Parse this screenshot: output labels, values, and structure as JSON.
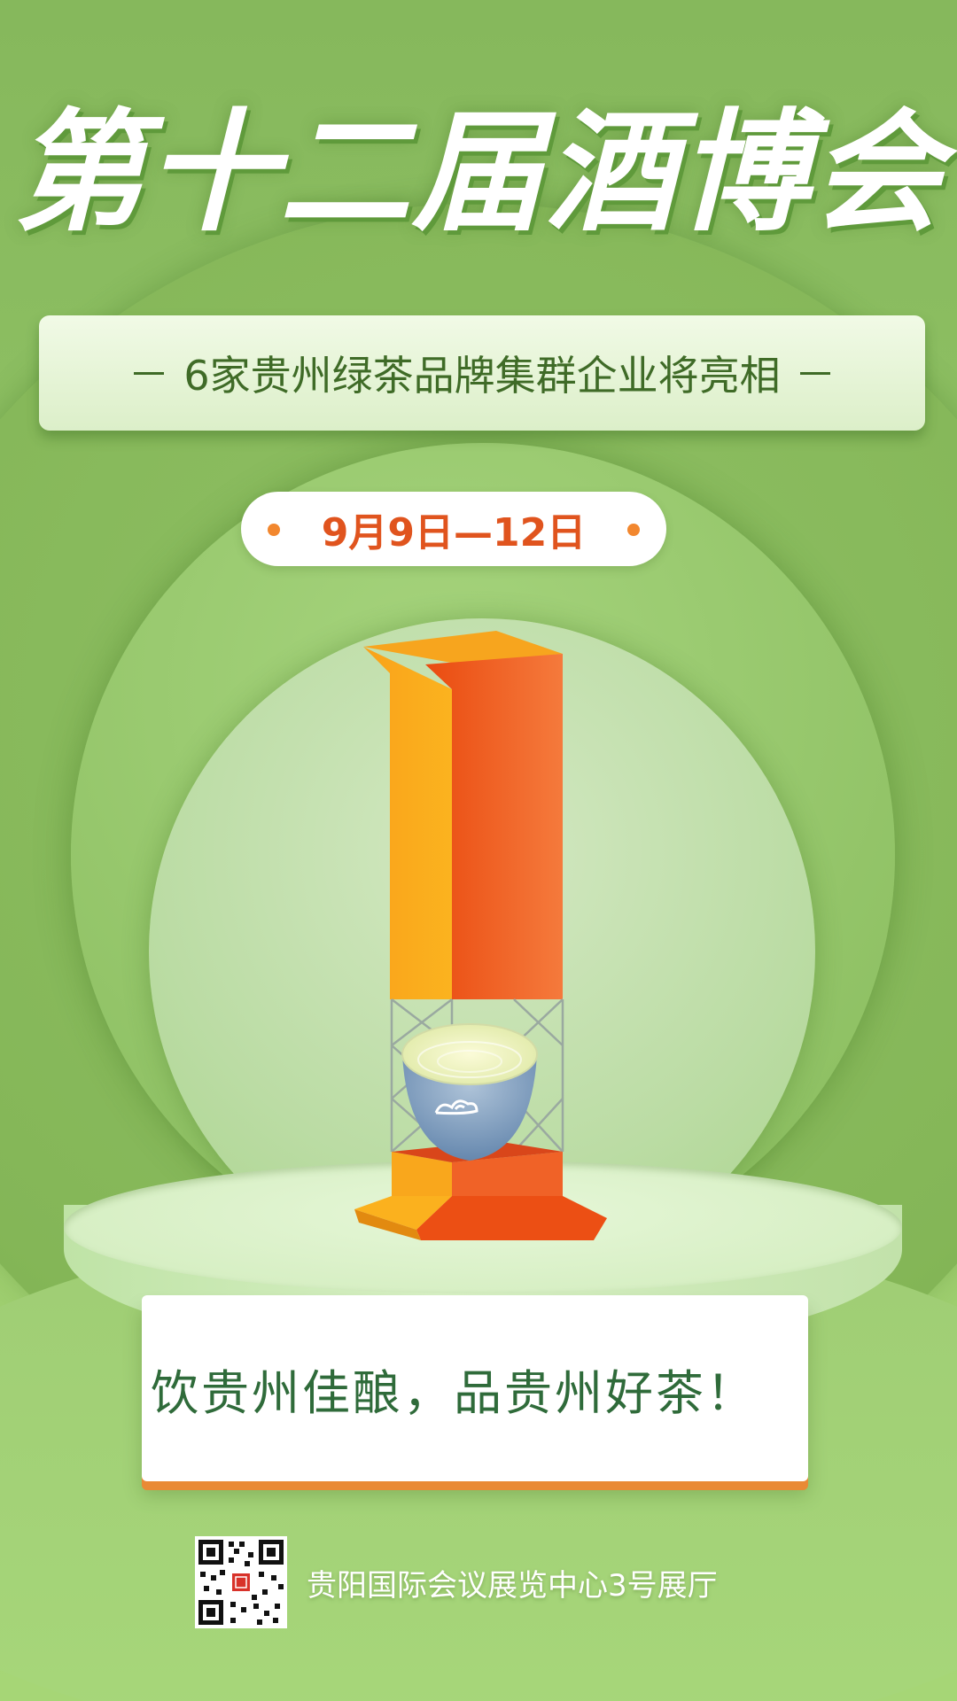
{
  "poster": {
    "title": "第十二届酒博会",
    "subtitle": "6家贵州绿茶品牌集群企业将亮相",
    "date": "9月9日—12日",
    "slogan": "饮贵州佳酿，品贵州好茶！",
    "venue": "贵阳国际会议展览中心3号展厅"
  },
  "colors": {
    "background": "#8fc164",
    "title": "#ffffff",
    "date_text": "#e0541e",
    "slogan_text": "#2f6b3a",
    "accent_orange": "#f2872e",
    "cup_blue": "#6d8fb6"
  },
  "icons": {
    "qr": "qr-code-icon",
    "cloud": "cloud-icon"
  }
}
